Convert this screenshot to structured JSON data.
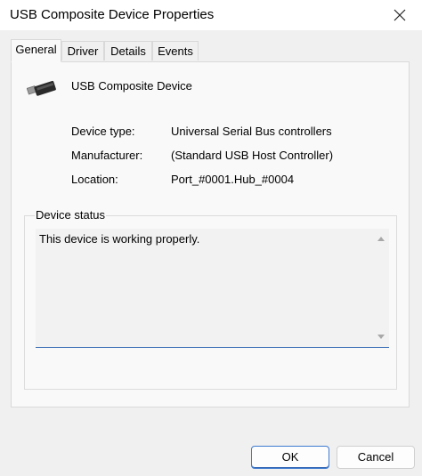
{
  "window": {
    "title": "USB Composite Device Properties"
  },
  "tabs": [
    {
      "label": "General",
      "active": true
    },
    {
      "label": "Driver",
      "active": false
    },
    {
      "label": "Details",
      "active": false
    },
    {
      "label": "Events",
      "active": false
    }
  ],
  "device": {
    "icon": "usb-plug-icon",
    "name": "USB Composite Device"
  },
  "properties": [
    {
      "label": "Device type:",
      "value": "Universal Serial Bus controllers"
    },
    {
      "label": "Manufacturer:",
      "value": "(Standard USB Host Controller)"
    },
    {
      "label": "Location:",
      "value": "Port_#0001.Hub_#0004"
    }
  ],
  "status": {
    "legend": "Device status",
    "text": "This device is working properly."
  },
  "buttons": {
    "ok": "OK",
    "cancel": "Cancel"
  },
  "colors": {
    "accent": "#3f7bd1"
  }
}
